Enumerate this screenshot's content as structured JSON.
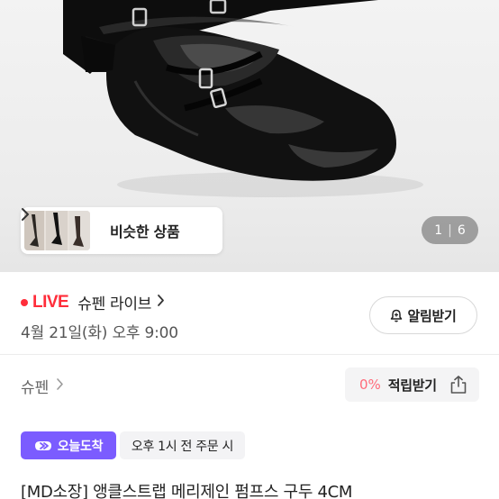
{
  "colors": {
    "live_red": "#ff2d3a",
    "badge_purple": "#7b5cff",
    "points_pink": "#ff6b7a"
  },
  "hero": {
    "similar_label": "비슷한 상품",
    "counter_current": "1",
    "counter_total": "6"
  },
  "live": {
    "badge": "LIVE",
    "name": "슈펜 라이브",
    "time": "4월 21일(화) 오후 9:00",
    "alarm_label": "알림받기"
  },
  "store": {
    "name": "슈펜",
    "points_pct": "0%",
    "points_label": "적립받기"
  },
  "delivery": {
    "today_label": "오늘도착",
    "cutoff_label": "오후 1시 전 주문 시"
  },
  "product": {
    "title": "[MD소장] 앵클스트랩 메리제인 펌프스 구두 4CM"
  }
}
